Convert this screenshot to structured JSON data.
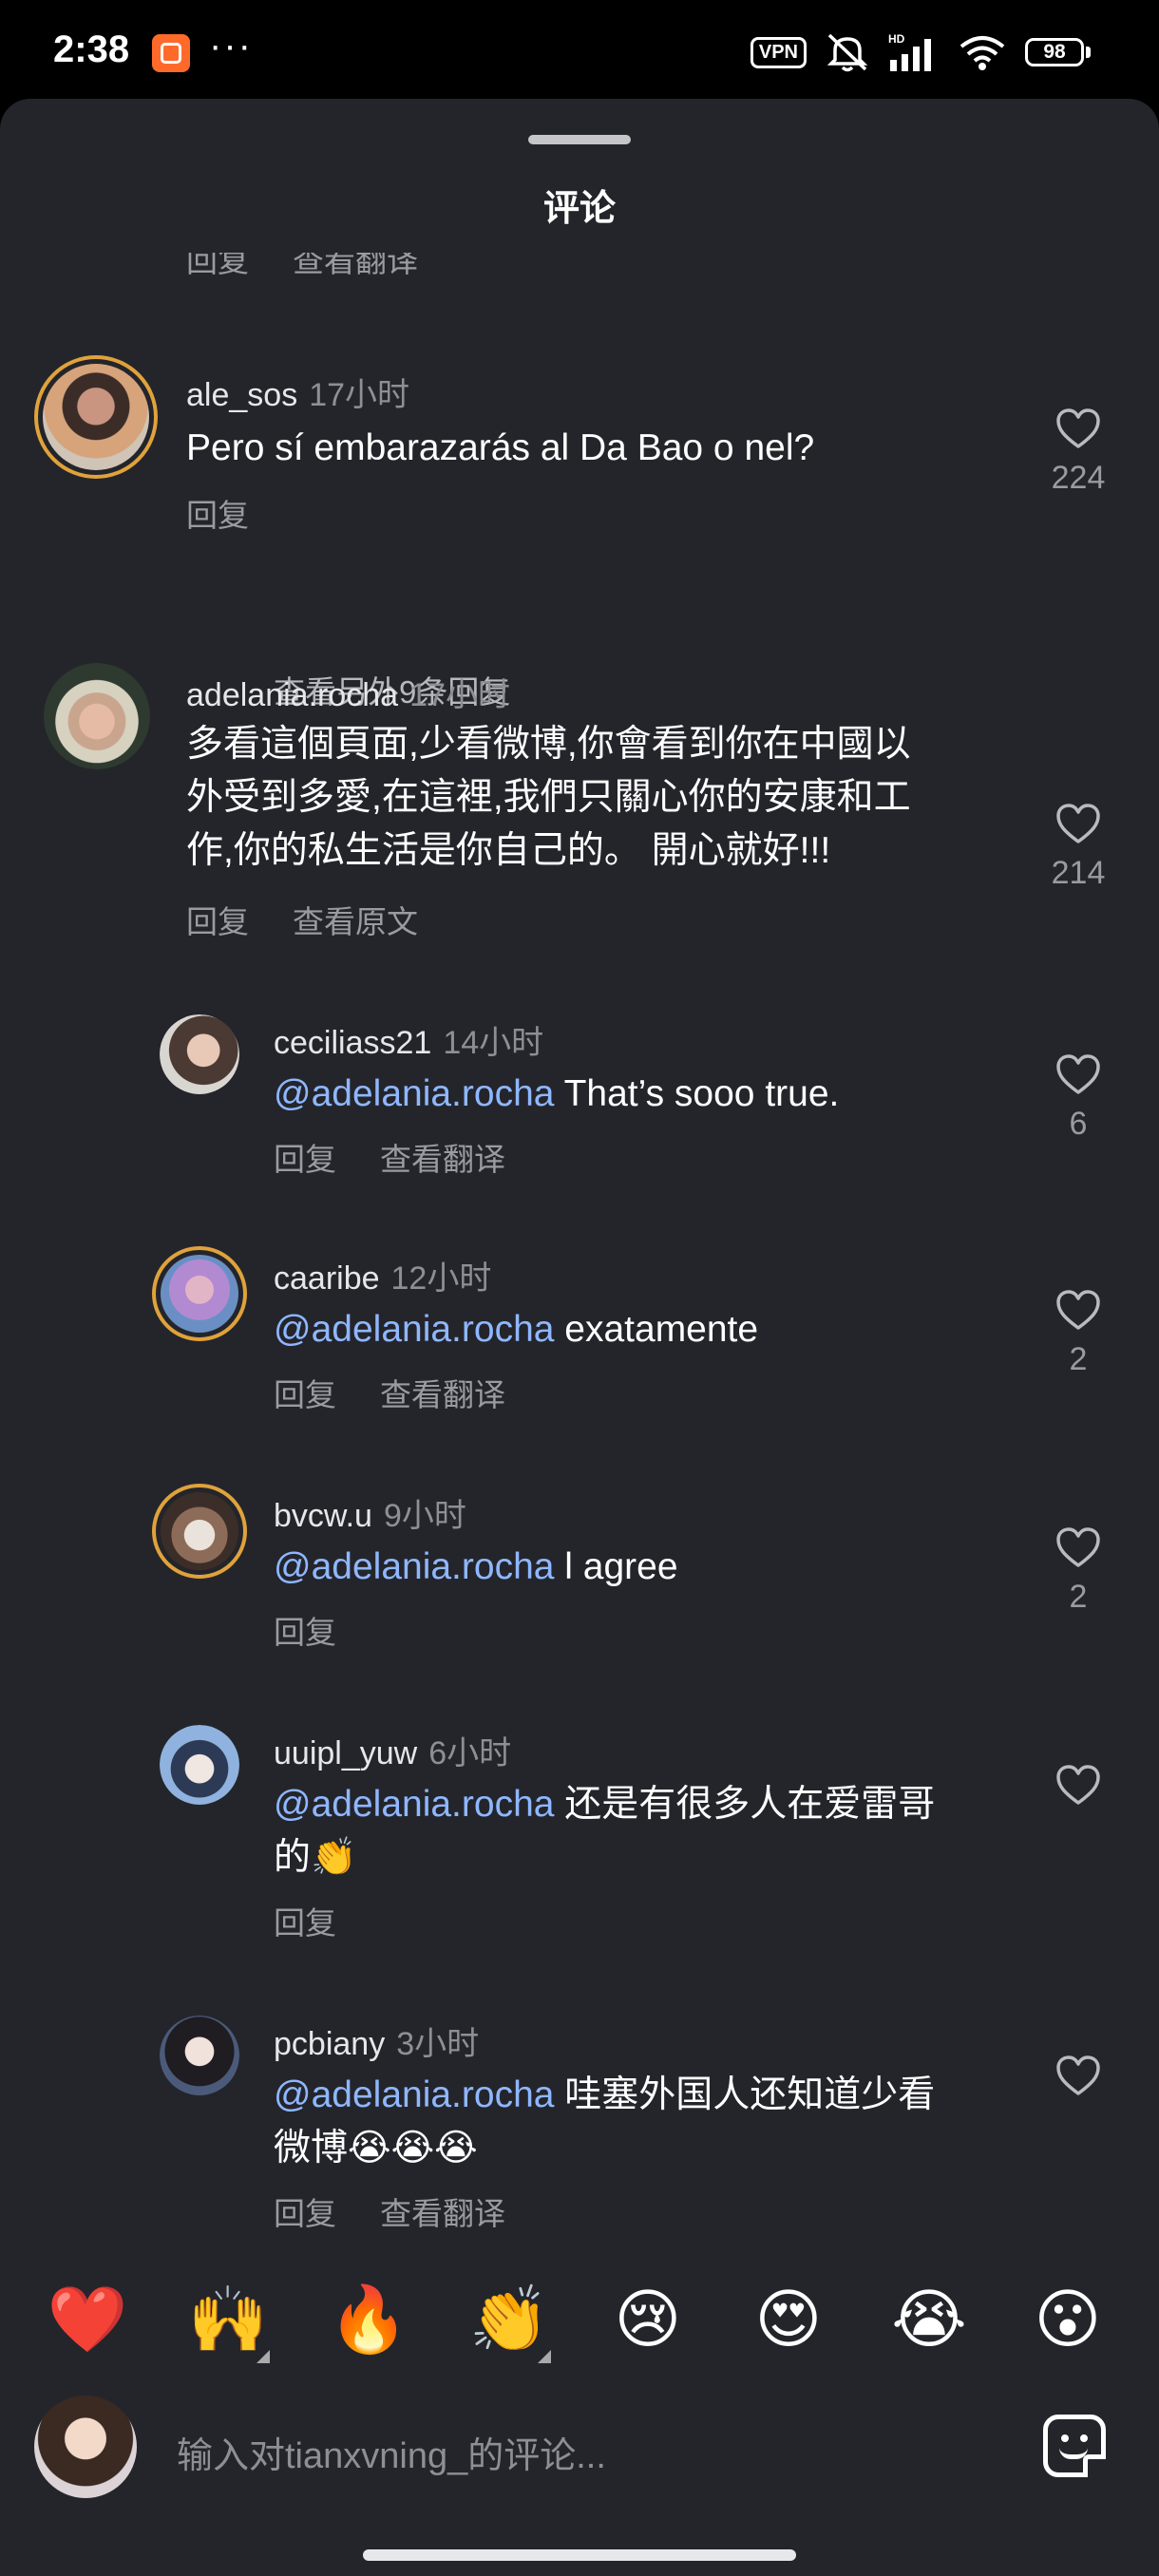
{
  "status_bar": {
    "time": "2:38",
    "dots": "···",
    "vpn": "VPN",
    "battery": "98"
  },
  "sheet": {
    "title": "评论"
  },
  "partial_actions": {
    "reply": "回复",
    "translate": "查看翻译"
  },
  "comments": [
    {
      "username": "ale_sos",
      "time": "17小时",
      "text": "Pero sí embarazarás al Da Bao o nel?",
      "reply": "回复",
      "likes": "224",
      "more_replies": "查看另外9条回复"
    },
    {
      "username": "adelania.rocha",
      "time": "17小时",
      "text_lines": [
        "多看這個頁面,少看微博,你會看到你在中國以",
        "外受到多愛,在這裡,我們只關心你的安康和工",
        "作,你的私生活是你自己的。 開心就好!!!"
      ],
      "reply": "回复",
      "secondary": "查看原文",
      "likes": "214"
    }
  ],
  "replies": [
    {
      "username": "ceciliass21",
      "time": "14小时",
      "mention": "@adelania.rocha",
      "text": " That’s sooo true.",
      "reply": "回复",
      "secondary": "查看翻译",
      "likes": "6"
    },
    {
      "username": "caaribe",
      "time": "12小时",
      "mention": "@adelania.rocha",
      "text": " exatamente",
      "reply": "回复",
      "secondary": "查看翻译",
      "likes": "2"
    },
    {
      "username": "bvcw.u",
      "time": "9小时",
      "mention": "@adelania.rocha",
      "text": " l agree",
      "reply": "回复",
      "likes": "2"
    },
    {
      "username": "uuipl_yuw",
      "time": "6小时",
      "mention": "@adelania.rocha",
      "text": " 还是有很多人在爱雷哥",
      "text2": "的👏",
      "reply": "回复"
    },
    {
      "username": "pcbiany",
      "time": "3小时",
      "mention": "@adelania.rocha",
      "text": " 哇塞外国人还知道少看",
      "text2": "微博😭😭😭",
      "reply": "回复",
      "secondary": "查看翻译"
    }
  ],
  "emoji_bar": [
    "❤️",
    "🙌",
    "🔥",
    "👏",
    "😢",
    "😍",
    "😭",
    "😮"
  ],
  "input": {
    "placeholder": "输入对tianxvning_的评论..."
  },
  "icons": {
    "like": "heart-outline-icon",
    "sticker": "sticker-icon"
  }
}
